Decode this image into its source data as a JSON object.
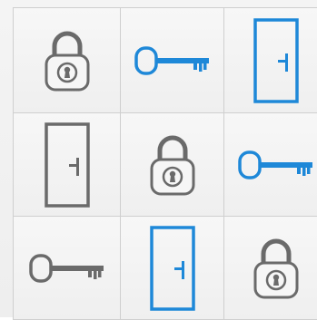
{
  "colors": {
    "gray": "#6a6a6a",
    "blue": "#1e88d8",
    "grid_line": "#cfcfcf"
  },
  "board": {
    "rows": [
      [
        {
          "icon": "padlock-icon",
          "color": "gray"
        },
        {
          "icon": "key-icon",
          "color": "blue"
        },
        {
          "icon": "door-icon",
          "color": "blue"
        }
      ],
      [
        {
          "icon": "door-icon",
          "color": "gray"
        },
        {
          "icon": "padlock-icon",
          "color": "gray"
        },
        {
          "icon": "key-icon",
          "color": "blue"
        }
      ],
      [
        {
          "icon": "key-icon",
          "color": "gray"
        },
        {
          "icon": "door-icon",
          "color": "blue"
        },
        {
          "icon": "padlock-icon",
          "color": "gray"
        }
      ]
    ]
  }
}
